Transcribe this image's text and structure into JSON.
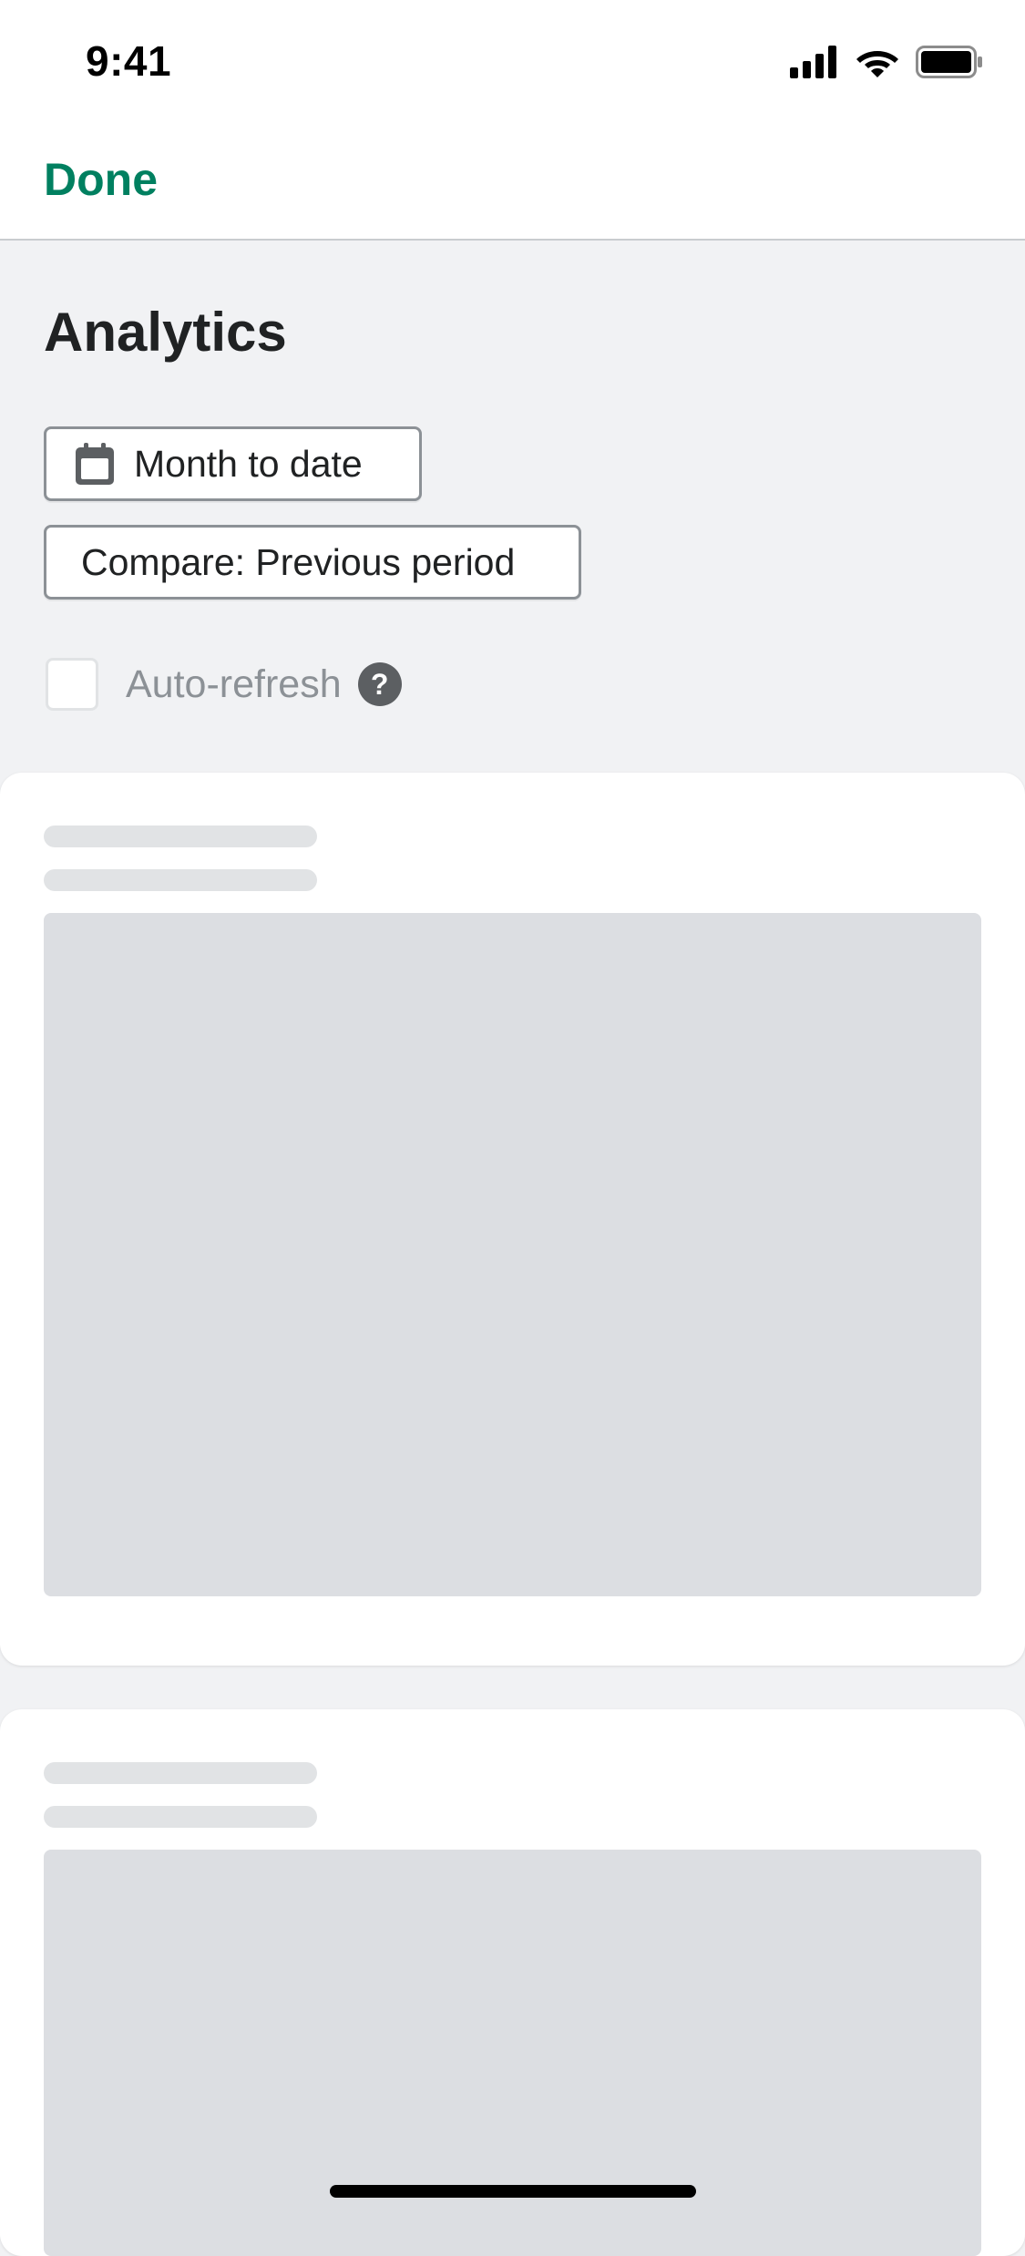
{
  "status_bar": {
    "time": "9:41",
    "icons": [
      "cellular-signal-icon",
      "wifi-icon",
      "battery-icon"
    ]
  },
  "nav": {
    "done_label": "Done"
  },
  "page": {
    "title": "Analytics"
  },
  "filters": {
    "date_range_label": "Month to date",
    "date_icon": "calendar-icon",
    "compare_label": "Compare: Previous period"
  },
  "auto_refresh": {
    "label": "Auto-refresh",
    "checked": false,
    "help_icon": "question-mark-icon",
    "help_glyph": "?"
  },
  "colors": {
    "accent": "#008060",
    "background": "#f1f2f4",
    "skeleton": "#dcdee2",
    "icon": "#5c5f62"
  }
}
